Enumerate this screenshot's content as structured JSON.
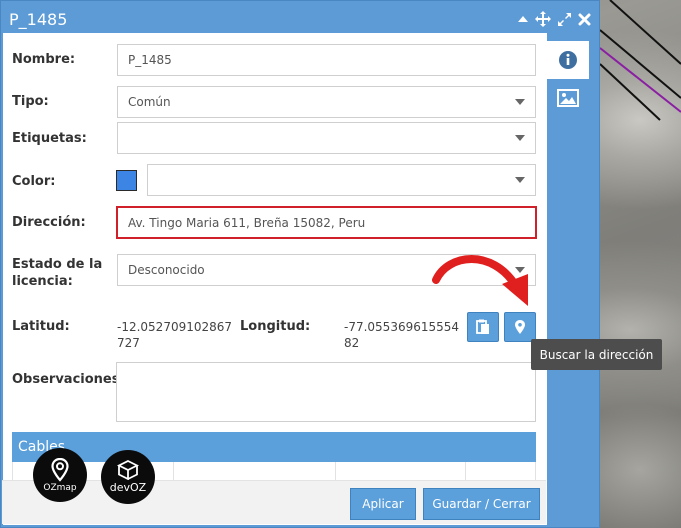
{
  "window": {
    "title": "P_1485"
  },
  "form": {
    "nombre_label": "Nombre:",
    "nombre_value": "P_1485",
    "tipo_label": "Tipo:",
    "tipo_value": "Común",
    "etiquetas_label": "Etiquetas:",
    "etiquetas_value": "",
    "color_label": "Color:",
    "color_swatch": "#3d85e4",
    "color_value": "",
    "direccion_label": "Dirección:",
    "direccion_value": "Av. Tingo Maria 611, Breña 15082, Peru",
    "estado_label_line1": "Estado de la",
    "estado_label_line2": "licencia:",
    "estado_value": "Desconocido",
    "latitud_label": "Latitud:",
    "latitud_value": "-12.052709102867727",
    "longitud_label": "Longitud:",
    "longitud_value": "-77.05536961555482",
    "observaciones_label": "Observaciones:"
  },
  "sections": {
    "cables_title": "Cables"
  },
  "footer": {
    "apply_label": "Aplicar",
    "save_close_label": "Guardar / Cerrar"
  },
  "tooltip": {
    "text": "Buscar la dirección"
  },
  "logos": {
    "ozmap": "OZmap",
    "devoz": "devOZ"
  },
  "colors": {
    "accent": "#5b9fdb",
    "error_border": "#d0202a",
    "annotation_arrow": "#e0201f"
  }
}
